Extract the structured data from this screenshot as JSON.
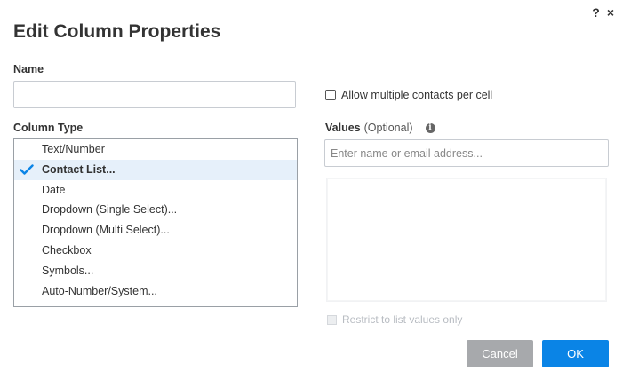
{
  "dialog": {
    "title": "Edit Column Properties",
    "help_icon": "?",
    "close_icon": "×"
  },
  "name": {
    "label": "Name",
    "value": "",
    "placeholder": ""
  },
  "column_type": {
    "label": "Column Type",
    "items": [
      {
        "label": "Text/Number",
        "selected": false
      },
      {
        "label": "Contact List...",
        "selected": true
      },
      {
        "label": "Date",
        "selected": false
      },
      {
        "label": "Dropdown (Single Select)...",
        "selected": false
      },
      {
        "label": "Dropdown (Multi Select)...",
        "selected": false
      },
      {
        "label": "Checkbox",
        "selected": false
      },
      {
        "label": "Symbols...",
        "selected": false
      },
      {
        "label": "Auto-Number/System...",
        "selected": false
      }
    ]
  },
  "allow_multiple": {
    "label": "Allow multiple contacts per cell",
    "checked": false
  },
  "values": {
    "label": "Values",
    "optional": "(Optional)",
    "info_icon": "i",
    "placeholder": "Enter name or email address..."
  },
  "restrict": {
    "label": "Restrict to list values only",
    "checked": false,
    "disabled": true
  },
  "buttons": {
    "cancel": "Cancel",
    "ok": "OK"
  },
  "colors": {
    "accent": "#0a84e6",
    "selected_row": "#e6f0fa",
    "cancel_button": "#a7a9ac"
  }
}
